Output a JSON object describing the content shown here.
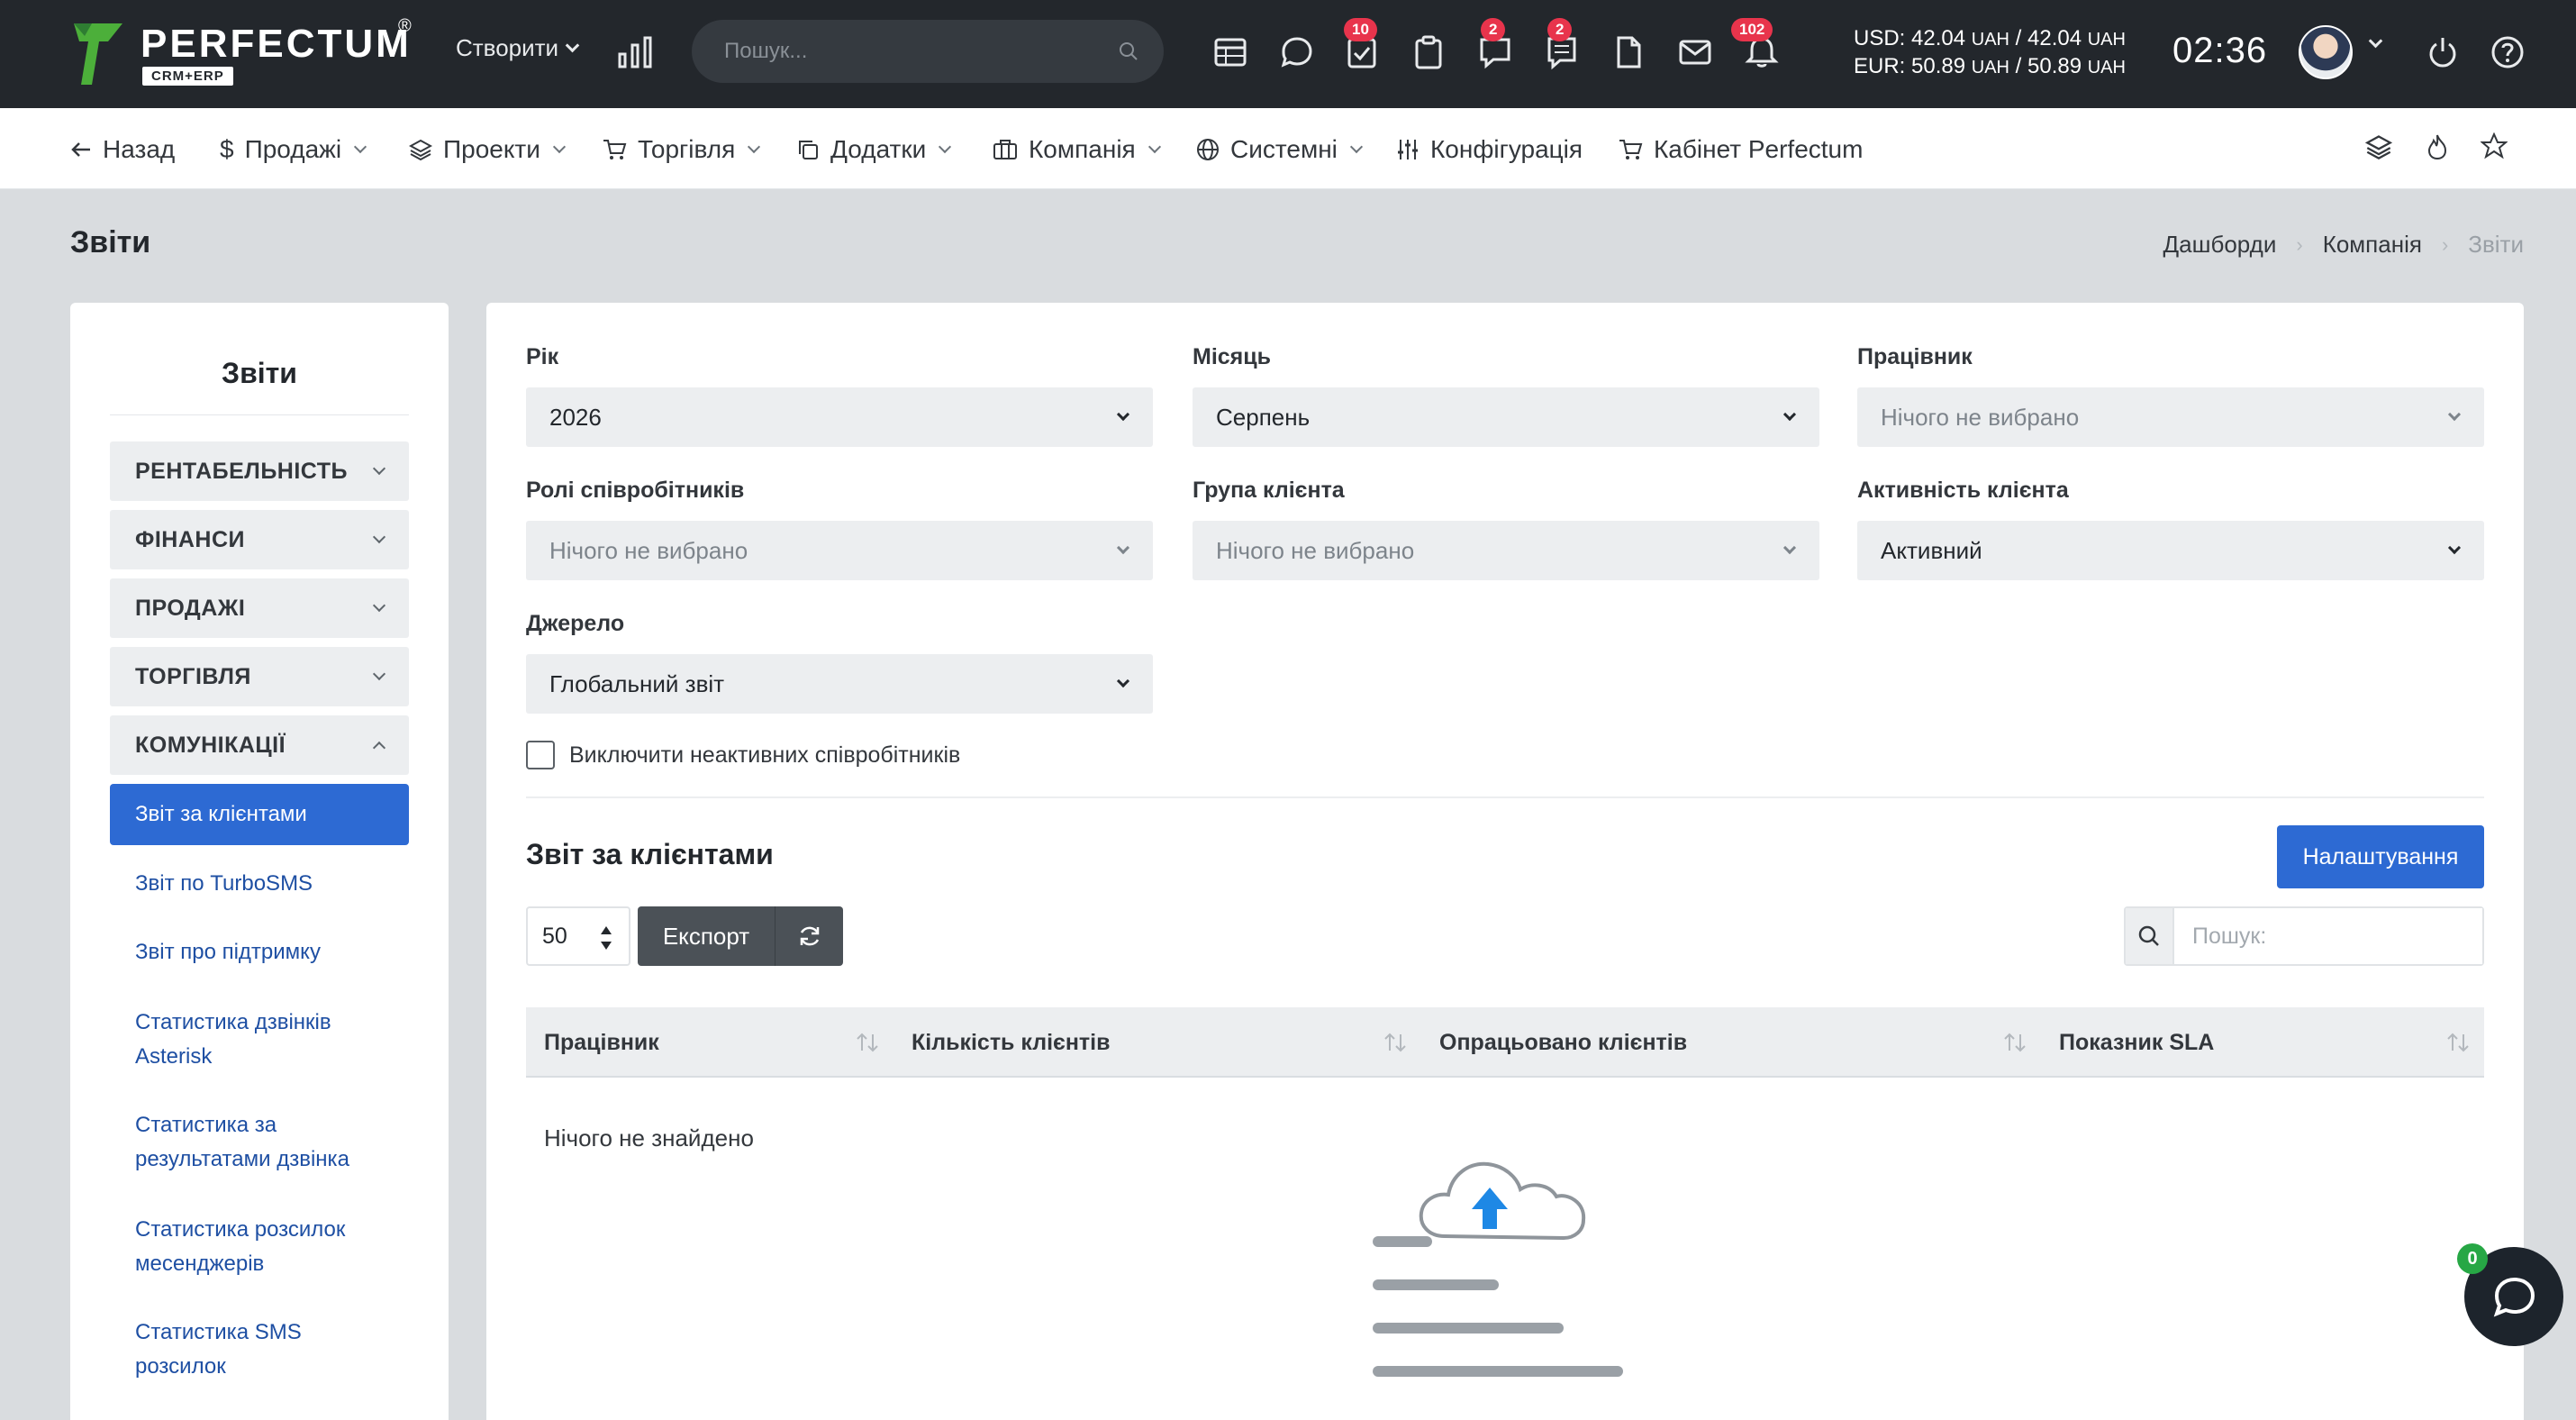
{
  "topbar": {
    "logo_text": "PERFECTUM",
    "logo_reg": "®",
    "logo_sub": "CRM+ERP",
    "create_label": "Створити",
    "search_placeholder": "Пошук...",
    "badges": {
      "tasks": "10",
      "discussions": "2",
      "notes": "2",
      "notifications": "102"
    },
    "currency": {
      "usd_label": "USD:",
      "usd_buy": "42.04",
      "usd_sell": "42.04",
      "usd_unit": "UAH",
      "eur_label": "EUR:",
      "eur_buy": "50.89",
      "eur_sell": "50.89",
      "eur_unit": "UAH",
      "slash": "/"
    },
    "clock": "02:36"
  },
  "navbar": {
    "back": "Назад",
    "sales": "Продажі",
    "projects": "Проекти",
    "trade": "Торгівля",
    "addons": "Додатки",
    "company": "Компанія",
    "system": "Системні",
    "config": "Конфігурація",
    "cabinet": "Кабінет Perfectum"
  },
  "page": {
    "title": "Звіти",
    "breadcrumb": [
      "Дашборди",
      "Компанія",
      "Звіти"
    ]
  },
  "sidebar": {
    "title": "Звіти",
    "groups": [
      "РЕНТАБЕЛЬНІСТЬ",
      "ФІНАНСИ",
      "ПРОДАЖІ",
      "ТОРГІВЛЯ",
      "КОМУНІКАЦІЇ"
    ],
    "links": [
      "Звіт за клієнтами",
      "Звіт по TurboSMS",
      "Звіт про підтримку",
      "Статистика дзвінків Asterisk",
      "Статистика за результатами дзвінка",
      "Статистика розсилок месенджерів",
      "Статистика SMS розсилок"
    ]
  },
  "filters": {
    "year": {
      "label": "Рік",
      "value": "2026"
    },
    "month": {
      "label": "Місяць",
      "value": "Серпень"
    },
    "employee": {
      "label": "Працівник",
      "value": "Нічого не вибрано"
    },
    "roles": {
      "label": "Ролі співробітників",
      "value": "Нічого не вибрано"
    },
    "client_group": {
      "label": "Група клієнта",
      "value": "Нічого не вибрано"
    },
    "client_activity": {
      "label": "Активність клієнта",
      "value": "Активний"
    },
    "source": {
      "label": "Джерело",
      "value": "Глобальний звіт"
    },
    "exclude_inactive": "Виключити неактивних співробітників"
  },
  "report": {
    "title": "Звіт за клієнтами",
    "settings_label": "Налаштування",
    "page_size": "50",
    "export_label": "Експорт",
    "search_placeholder": "Пошук:",
    "columns": [
      "Працівник",
      "Кількість клієнтів",
      "Опрацьовано клієнтів",
      "Показник SLA"
    ],
    "empty": "Нічого не знайдено"
  },
  "chat": {
    "badge": "0"
  },
  "colors": {
    "topbar": "#23272c",
    "primary": "#2d6ad3",
    "badge": "#e8344c",
    "logo_green": "#4caf3a"
  }
}
